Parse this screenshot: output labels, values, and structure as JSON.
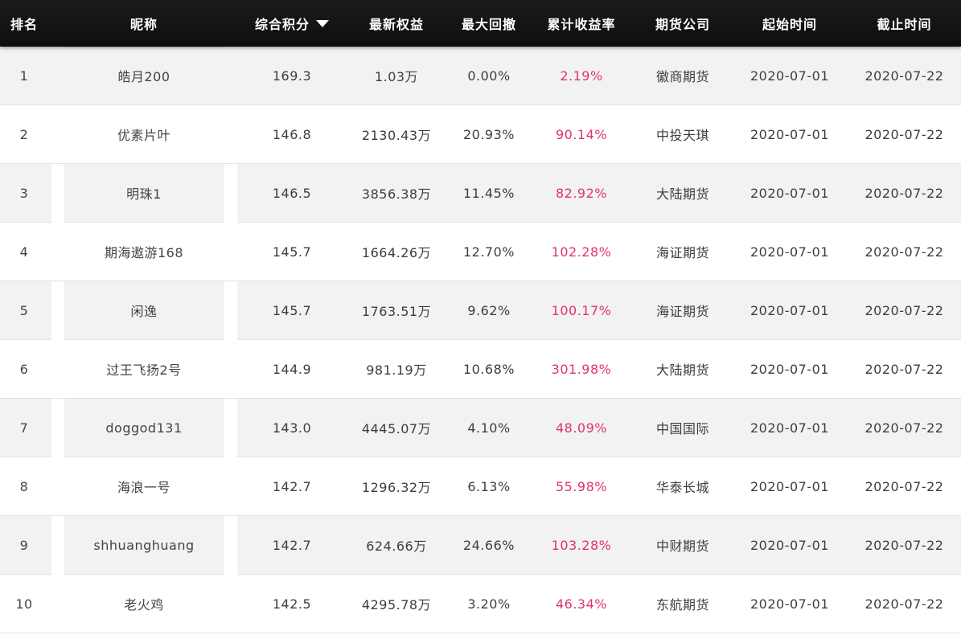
{
  "table": {
    "headers": {
      "rank": "排名",
      "nickname": "昵称",
      "score": "综合积分",
      "equity": "最新权益",
      "drawdown": "最大回撤",
      "yield": "累计收益率",
      "broker": "期货公司",
      "start": "起始时间",
      "end": "截止时间"
    },
    "sort": {
      "column": "score",
      "direction": "descending",
      "icon": "sort-down-triangle-icon"
    },
    "colors": {
      "header_bg": "#111111",
      "header_text": "#ffffff",
      "yield_text": "#e2336b",
      "odd_row_bg": "#f2f2f2",
      "even_row_bg": "#ffffff"
    },
    "rows": [
      {
        "rank": "1",
        "nickname": "皓月200",
        "score": "169.3",
        "equity": "1.03万",
        "drawdown": "0.00%",
        "yield": "2.19%",
        "broker": "徽商期货",
        "start": "2020-07-01",
        "end": "2020-07-22"
      },
      {
        "rank": "2",
        "nickname": "优素片叶",
        "score": "146.8",
        "equity": "2130.43万",
        "drawdown": "20.93%",
        "yield": "90.14%",
        "broker": "中投天琪",
        "start": "2020-07-01",
        "end": "2020-07-22"
      },
      {
        "rank": "3",
        "nickname": "明珠1",
        "score": "146.5",
        "equity": "3856.38万",
        "drawdown": "11.45%",
        "yield": "82.92%",
        "broker": "大陆期货",
        "start": "2020-07-01",
        "end": "2020-07-22"
      },
      {
        "rank": "4",
        "nickname": "期海遨游168",
        "score": "145.7",
        "equity": "1664.26万",
        "drawdown": "12.70%",
        "yield": "102.28%",
        "broker": "海证期货",
        "start": "2020-07-01",
        "end": "2020-07-22"
      },
      {
        "rank": "5",
        "nickname": "闲逸",
        "score": "145.7",
        "equity": "1763.51万",
        "drawdown": "9.62%",
        "yield": "100.17%",
        "broker": "海证期货",
        "start": "2020-07-01",
        "end": "2020-07-22"
      },
      {
        "rank": "6",
        "nickname": "过王飞扬2号",
        "score": "144.9",
        "equity": "981.19万",
        "drawdown": "10.68%",
        "yield": "301.98%",
        "broker": "大陆期货",
        "start": "2020-07-01",
        "end": "2020-07-22"
      },
      {
        "rank": "7",
        "nickname": "doggod131",
        "score": "143.0",
        "equity": "4445.07万",
        "drawdown": "4.10%",
        "yield": "48.09%",
        "broker": "中国国际",
        "start": "2020-07-01",
        "end": "2020-07-22"
      },
      {
        "rank": "8",
        "nickname": "海浪一号",
        "score": "142.7",
        "equity": "1296.32万",
        "drawdown": "6.13%",
        "yield": "55.98%",
        "broker": "华泰长城",
        "start": "2020-07-01",
        "end": "2020-07-22"
      },
      {
        "rank": "9",
        "nickname": "shhuanghuang",
        "score": "142.7",
        "equity": "624.66万",
        "drawdown": "24.66%",
        "yield": "103.28%",
        "broker": "中财期货",
        "start": "2020-07-01",
        "end": "2020-07-22"
      },
      {
        "rank": "10",
        "nickname": "老火鸡",
        "score": "142.5",
        "equity": "4295.78万",
        "drawdown": "3.20%",
        "yield": "46.34%",
        "broker": "东航期货",
        "start": "2020-07-01",
        "end": "2020-07-22"
      }
    ]
  }
}
